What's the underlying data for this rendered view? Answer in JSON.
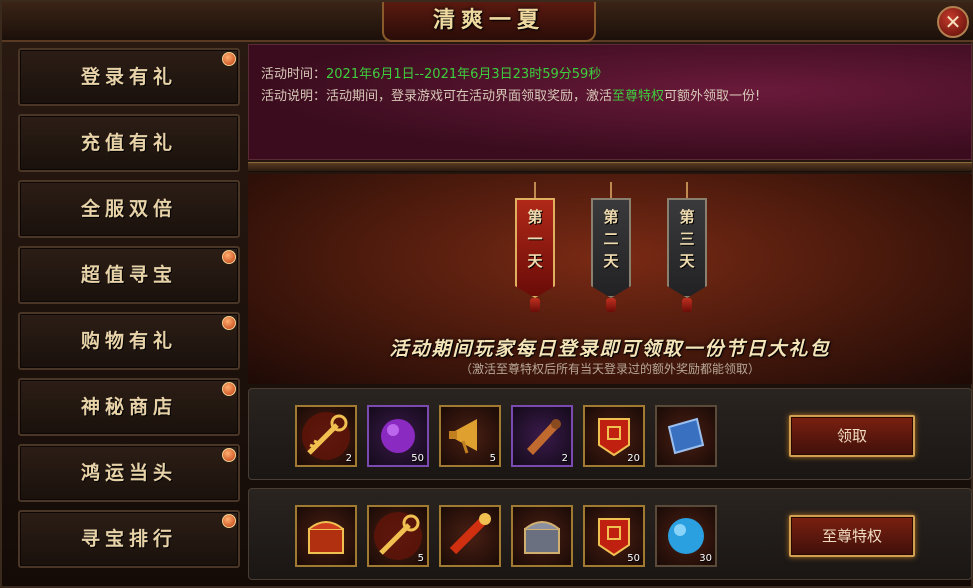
{
  "window": {
    "title": "清爽一夏",
    "close_symbol": "✕"
  },
  "sidebar": {
    "items": [
      {
        "label": "登录有礼",
        "active": true,
        "badge": true
      },
      {
        "label": "充值有礼",
        "active": false,
        "badge": false
      },
      {
        "label": "全服双倍",
        "active": false,
        "badge": false
      },
      {
        "label": "超值寻宝",
        "active": false,
        "badge": true
      },
      {
        "label": "购物有礼",
        "active": false,
        "badge": true
      },
      {
        "label": "神秘商店",
        "active": false,
        "badge": true
      },
      {
        "label": "鸿运当头",
        "active": false,
        "badge": true
      },
      {
        "label": "寻宝排行",
        "active": false,
        "badge": true
      }
    ]
  },
  "info": {
    "time_label": "活动时间：",
    "time_value": "2021年6月1日--2021年6月3日23时59分59秒",
    "desc_label": "活动说明：",
    "desc_part1": "活动期间，登录游戏可在活动界面领取奖励，激活",
    "desc_highlight": "至尊特权",
    "desc_part2": "可额外领取一份!"
  },
  "days": [
    {
      "label": "第一天",
      "active": true
    },
    {
      "label": "第二天",
      "active": false
    },
    {
      "label": "第三天",
      "active": false
    }
  ],
  "stage": {
    "title": "活动期间玩家每日登录即可领取一份节日大礼包",
    "subtitle": "（激活至尊特权后所有当天登录过的额外奖励都能领取）"
  },
  "rewards": {
    "normal": {
      "button_label": "领取",
      "items": [
        {
          "icon": "golden-key-icon",
          "count": "2"
        },
        {
          "icon": "purple-orb-icon",
          "count": "50"
        },
        {
          "icon": "horn-icon",
          "count": "5"
        },
        {
          "icon": "scroll-roll-icon",
          "count": "2"
        },
        {
          "icon": "red-seal-icon",
          "count": "20"
        },
        {
          "icon": "blue-scroll-icon",
          "count": ""
        }
      ]
    },
    "premium": {
      "button_label": "至尊特权",
      "items": [
        {
          "icon": "red-chest-icon",
          "count": ""
        },
        {
          "icon": "golden-key-icon",
          "count": "5"
        },
        {
          "icon": "red-firework-icon",
          "count": ""
        },
        {
          "icon": "silver-chest-icon",
          "count": ""
        },
        {
          "icon": "red-seal-icon",
          "count": "50"
        },
        {
          "icon": "blue-orb-icon",
          "count": "30"
        }
      ]
    }
  },
  "colors": {
    "accent_green": "#3ecf3e",
    "gold_border": "#d0a050",
    "active_red": "#b02818"
  }
}
